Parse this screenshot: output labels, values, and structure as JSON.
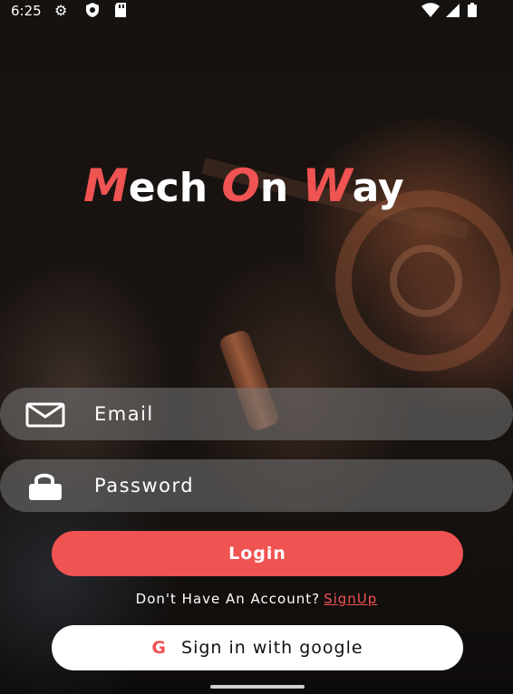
{
  "status_bar": {
    "time": "6:25",
    "icons": [
      "gear-icon",
      "shield-icon",
      "sd-card-icon",
      "wifi-icon",
      "signal-icon",
      "battery-icon"
    ]
  },
  "logo": {
    "part1_accent": "M",
    "part1_rest": "ech",
    "part2_accent": "O",
    "part2_rest": "n",
    "part3_accent": "W",
    "part3_rest": "ay"
  },
  "form": {
    "email_placeholder": "Email",
    "password_placeholder": "Password",
    "login_label": "Login",
    "no_account_text": "Don't Have An Account?",
    "signup_label": "SignUp",
    "google_icon_glyph": "G",
    "google_label": "Sign in with google"
  },
  "colors": {
    "accent": "#ef5352",
    "field_bg": "rgba(120,120,120,0.55)",
    "google_button_bg": "#ffffff"
  }
}
